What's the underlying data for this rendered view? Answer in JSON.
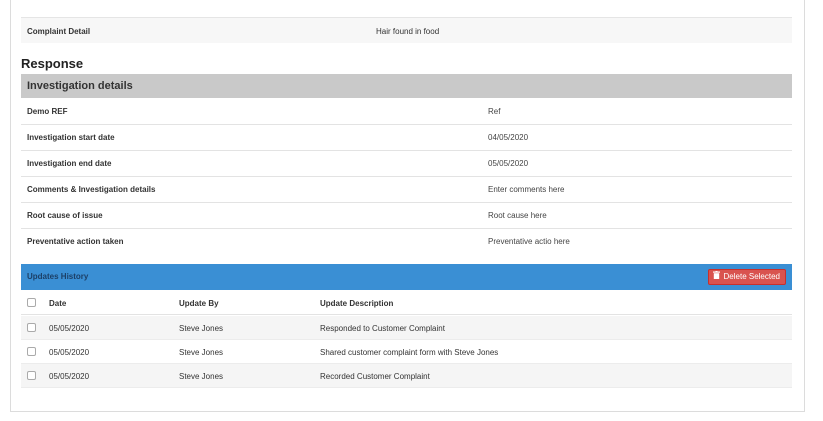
{
  "complaint": {
    "label": "Complaint Detail",
    "value": "Hair found in food"
  },
  "response": {
    "title": "Response",
    "section_title": "Investigation details",
    "rows": [
      {
        "label": "Demo REF",
        "value": "Ref"
      },
      {
        "label": "Investigation start date",
        "value": "04/05/2020"
      },
      {
        "label": "Investigation end date",
        "value": "05/05/2020"
      },
      {
        "label": "Comments & Investigation details",
        "value": "Enter comments here"
      },
      {
        "label": "Root cause of issue",
        "value": "Root cause here"
      },
      {
        "label": "Preventative action taken",
        "value": "Preventative actio here"
      }
    ]
  },
  "updates": {
    "title": "Updates History",
    "delete_label": "Delete Selected",
    "delete_icon": "trash-icon",
    "columns": [
      "Date",
      "Update By",
      "Update Description"
    ],
    "rows": [
      {
        "date": "05/05/2020",
        "by": "Steve Jones",
        "desc": "Responded to Customer Complaint"
      },
      {
        "date": "05/05/2020",
        "by": "Steve Jones",
        "desc": "Shared customer complaint form with Steve Jones"
      },
      {
        "date": "05/05/2020",
        "by": "Steve Jones",
        "desc": "Recorded Customer Complaint"
      }
    ]
  },
  "colors": {
    "header_bar": "#3a8fd4",
    "delete_button": "#d9534f",
    "section_header": "#c9c9c9"
  }
}
